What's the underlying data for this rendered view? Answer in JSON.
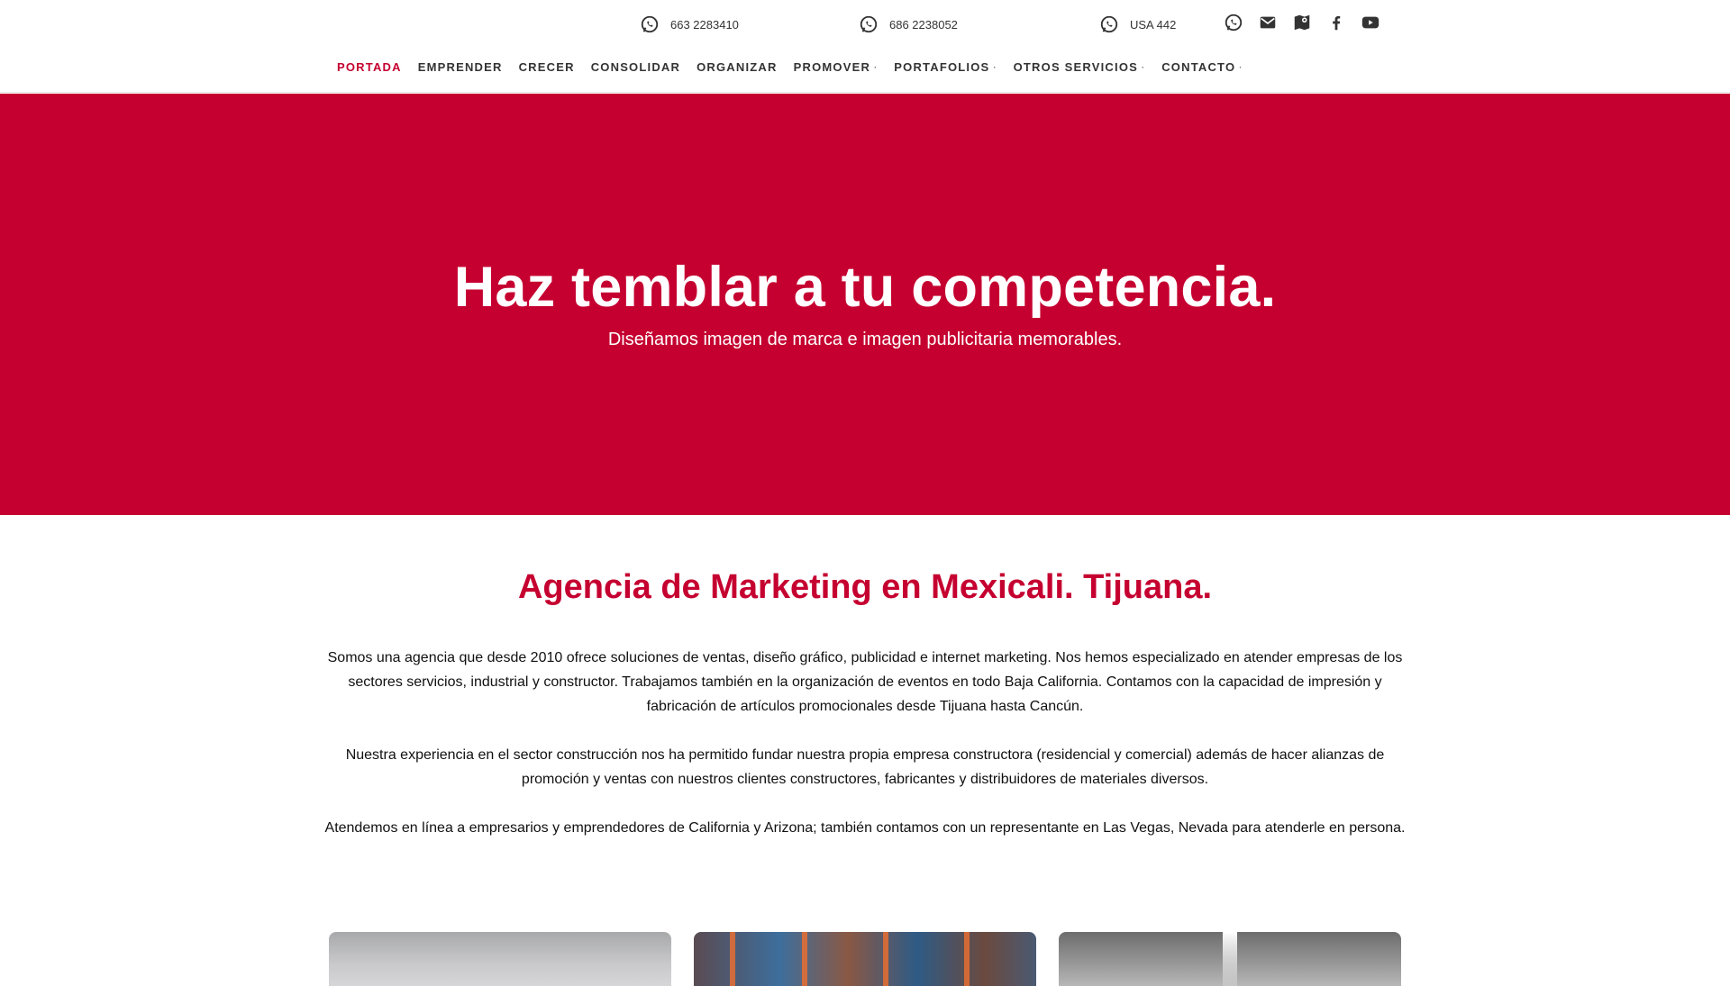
{
  "header": {
    "contacts": [
      {
        "icon": "whatsapp-icon",
        "text": "663 2283410"
      },
      {
        "icon": "whatsapp-icon",
        "text": "686 2238052"
      },
      {
        "icon": "whatsapp-icon",
        "text": "USA 442"
      }
    ],
    "social": [
      "whatsapp-icon",
      "mail-icon",
      "map-icon",
      "facebook-icon",
      "youtube-icon"
    ]
  },
  "nav": {
    "items": [
      {
        "label": "PORTADA",
        "active": true
      },
      {
        "label": "EMPRENDER"
      },
      {
        "label": "CRECER"
      },
      {
        "label": "CONSOLIDAR"
      },
      {
        "label": "ORGANIZAR"
      },
      {
        "label": "PROMOVER",
        "dropdown": "·"
      },
      {
        "label": "PORTAFOLIOS",
        "dropdown": "·"
      },
      {
        "label": "OTROS SERVICIOS",
        "dropdown": "·"
      },
      {
        "label": "CONTACTO",
        "dropdown": "·"
      }
    ]
  },
  "hero": {
    "title": "Haz temblar a tu competencia.",
    "subtitle": "Diseñamos imagen de marca e imagen publicitaria memorables."
  },
  "about": {
    "title": "Agencia de Marketing en Mexicali. Tijuana.",
    "p1": "Somos una agencia que desde 2010 ofrece soluciones de ventas, diseño gráfico, publicidad e internet marketing. Nos hemos especializado en atender empresas de los sectores servicios, industrial y constructor. Trabajamos también en la organización de eventos en todo Baja California. Contamos con la capacidad de impresión y fabricación de artículos promocionales desde Tijuana hasta Cancún.",
    "p2": "Nuestra experiencia en el sector construcción nos ha permitido fundar nuestra propia empresa constructora (residencial y comercial) además de hacer alianzas de promoción y ventas con nuestros clientes constructores, fabricantes y distribuidores de materiales diversos.",
    "p3": "Atendemos en línea a empresarios y emprendedores de California y Arizona; también contamos con un representante en Las Vegas, Nevada para atenderle en persona."
  },
  "colors": {
    "brand": "#c50030",
    "text": "#111111"
  }
}
